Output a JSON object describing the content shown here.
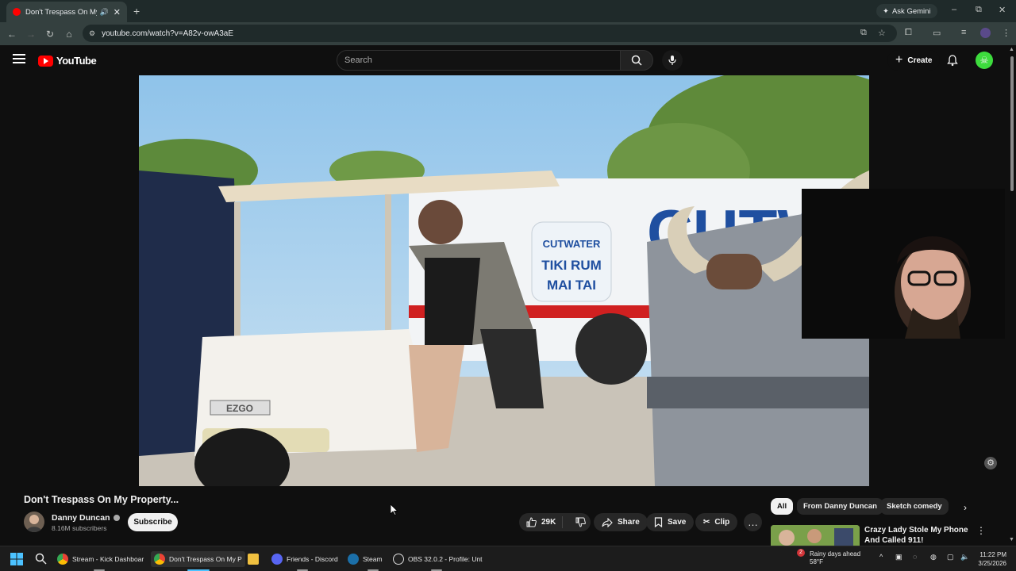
{
  "browser": {
    "tab_title": "Don't Trespass On My Prop",
    "new_tab": "+",
    "ask_gemini": "Ask Gemini",
    "url": "youtube.com/watch?v=A82v-owA3aE",
    "window_controls": [
      "–",
      "⧉",
      "✕"
    ]
  },
  "youtube": {
    "logo_text": "YouTube",
    "search_placeholder": "Search",
    "create_label": "Create"
  },
  "video": {
    "title": "Don't Trespass On My Property...",
    "channel_name": "Danny Duncan",
    "subscribers": "8.16M subscribers",
    "subscribe_label": "Subscribe",
    "like_count": "29K",
    "share_label": "Share",
    "save_label": "Save",
    "clip_label": "Clip",
    "more_label": "…",
    "scene_text": {
      "cart_brand": "EZGO",
      "can_brand": "CUTWATER",
      "can_line1": "TIKI RUM",
      "can_line2": "MAI TAI",
      "truck_text": "CUTWA"
    }
  },
  "sidebar": {
    "chips": [
      "All",
      "From Danny Duncan",
      "Sketch comedy"
    ],
    "active_chip": "All",
    "recommendation_title": "Crazy Lady Stole My Phone And Called 911!"
  },
  "taskbar": {
    "items": [
      {
        "label": "Stream - Kick Dashboar",
        "color": "#4285f4"
      },
      {
        "label": "Don't Trespass On My P",
        "color": "#4285f4"
      },
      {
        "label": "",
        "color": "#f0c040"
      },
      {
        "label": "Friends - Discord",
        "color": "#5865f2"
      },
      {
        "label": "Steam",
        "color": "#1b6fa8"
      },
      {
        "label": "OBS 32.0.2 - Profile: Unt",
        "color": "#222222"
      }
    ],
    "weather_line1": "Rainy days ahead",
    "weather_line2": "58°F",
    "time": "11:22 PM",
    "date": "3/25/2026",
    "notification_count": "2"
  },
  "colors": {
    "youtube_red": "#ff0000",
    "background": "#0f0f0f",
    "pill": "#272727",
    "account_avatar": "#3ddc3d"
  }
}
